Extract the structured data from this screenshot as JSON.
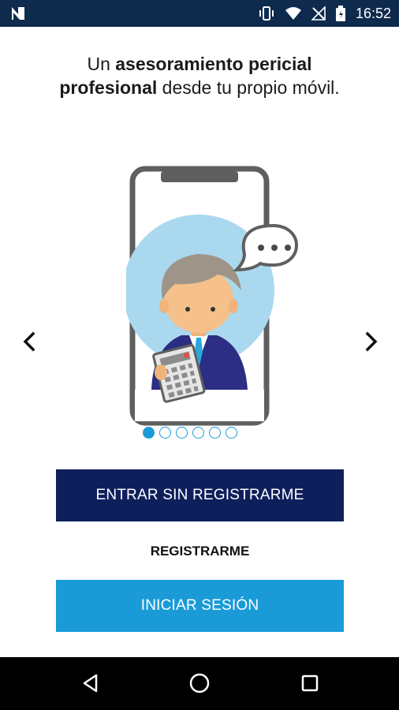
{
  "status_bar": {
    "time": "16:52",
    "icons": [
      "n-logo-icon",
      "vibrate-icon",
      "wifi-icon",
      "no-signal-icon",
      "battery-icon"
    ]
  },
  "headline": {
    "pre": "Un ",
    "bold": "asesoramiento pericial profesional",
    "post": " desde tu propio móvil."
  },
  "carousel": {
    "total_pages": 6,
    "active_page": 1,
    "illustration": "phone-expert-icon"
  },
  "buttons": {
    "guest": "ENTRAR SIN REGISTRARME",
    "register": "REGISTRARME",
    "login": "INICIAR SESIÓN"
  },
  "colors": {
    "status_bar": "#0e2b4e",
    "primary_dark": "#0f1f5c",
    "accent": "#1a9bd7"
  },
  "nav_bar": {
    "icons": [
      "back-icon",
      "home-icon",
      "recents-icon"
    ]
  }
}
